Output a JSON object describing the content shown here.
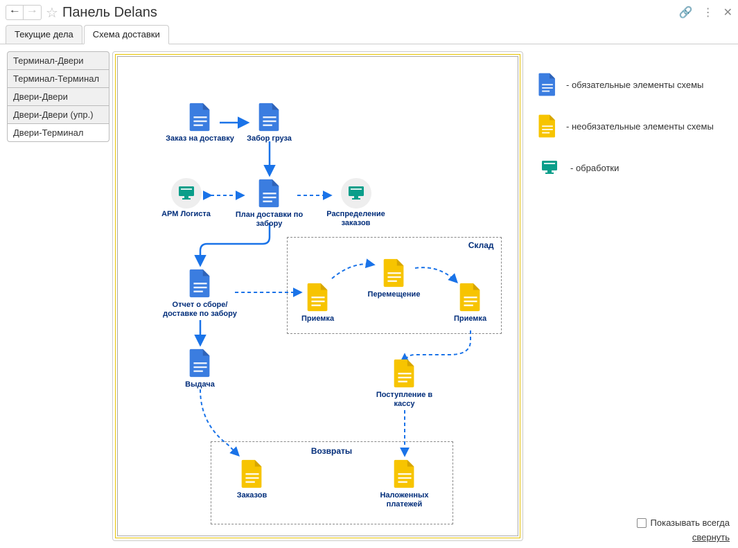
{
  "title": "Панель Delans",
  "tabs": [
    "Текущие дела",
    "Схема доставки"
  ],
  "active_tab": 1,
  "sidebar": {
    "items": [
      "Терминал-Двери",
      "Терминал-Терминал",
      "Двери-Двери",
      "Двери-Двери (упр.)",
      "Двери-Терминал"
    ],
    "selected": 4
  },
  "legend": {
    "mandatory": "- обязательные элементы схемы",
    "optional": "- необязательные элементы схемы",
    "processing": "- обработки"
  },
  "show_always": "Показывать всегда",
  "collapse": "свернуть",
  "nodes": {
    "order": "Заказ на доставку",
    "pickup": "Забор груза",
    "arm": "АРМ Логиста",
    "plan": "План доставки по забору",
    "distrib": "Распределение заказов",
    "report": "Отчет о сборе/доставке по забору",
    "accept1": "Приемка",
    "move": "Перемещение",
    "accept2": "Приемка",
    "issue": "Выдача",
    "cash": "Поступление в кассу",
    "ret_orders": "Заказов",
    "ret_pay": "Наложенных платежей"
  },
  "groups": {
    "warehouse": "Склад",
    "returns": "Возвраты"
  }
}
